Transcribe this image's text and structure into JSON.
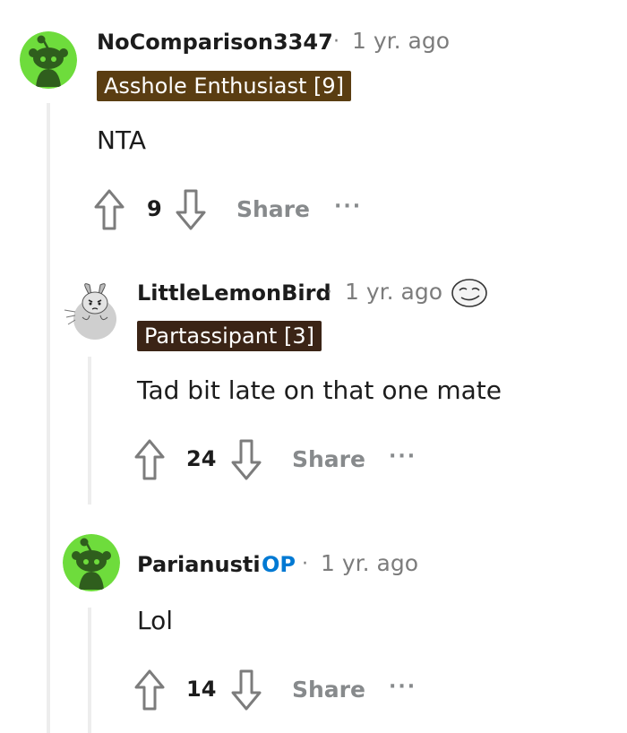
{
  "colors": {
    "flair_bg_1": "#5a3d12",
    "flair_bg_2": "#3b2416",
    "op": "#0079d3",
    "meta": "#7c7c7c",
    "avatar_green": "#6edc3c"
  },
  "comments": [
    {
      "username": "NoComparison3347",
      "separator": "·",
      "time": "1 yr. ago",
      "flair": "Asshole Enthusiast [9]",
      "body": "NTA",
      "votes": "9",
      "share_label": "Share",
      "more_label": "···",
      "avatar_icon": "snoo-avatar-icon"
    },
    {
      "username": "LittleLemonBird",
      "separator": "·",
      "time": "1 yr. ago",
      "award_icon": "sticker-award-icon",
      "flair": "Partassipant [3]",
      "body": "Tad bit late on that one mate",
      "votes": "24",
      "share_label": "Share",
      "more_label": "···",
      "avatar_icon": "bunny-avatar-icon"
    },
    {
      "username": "Parianusti",
      "op_badge": "OP",
      "separator": "·",
      "time": "1 yr. ago",
      "body": "Lol",
      "votes": "14",
      "share_label": "Share",
      "more_label": "···",
      "avatar_icon": "snoo-avatar-icon"
    }
  ]
}
